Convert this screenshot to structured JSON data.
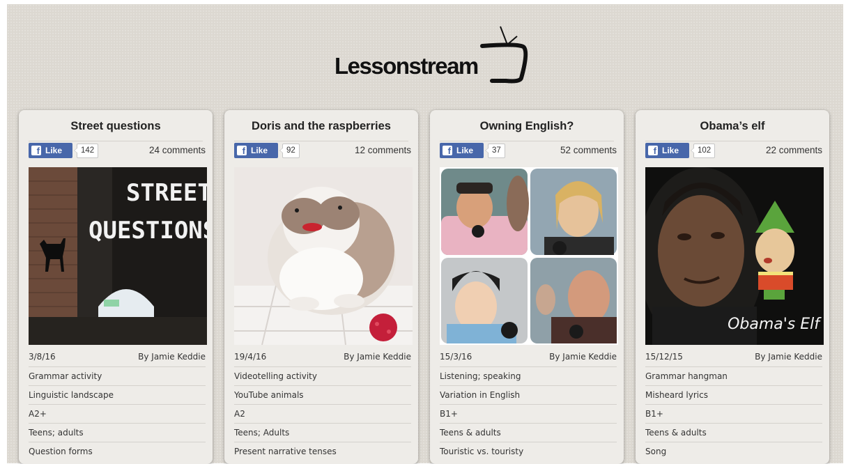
{
  "site": {
    "logo_text": "Lessonstream"
  },
  "lessons": [
    {
      "title": "Street questions",
      "like_label": "Like",
      "like_count": "142",
      "comments": "24 comments",
      "thumbnail": {
        "caption_line1": "STREET",
        "caption_line2": "QUESTIONS"
      },
      "date": "3/8/16",
      "author": "By Jamie Keddie",
      "tags": [
        "Grammar activity",
        "Linguistic landscape",
        "A2+",
        "Teens; adults",
        "Question forms"
      ]
    },
    {
      "title": "Doris and the raspberries",
      "like_label": "Like",
      "like_count": "92",
      "comments": "12 comments",
      "thumbnail": {},
      "date": "19/4/16",
      "author": "By Jamie Keddie",
      "tags": [
        "Videotelling activity",
        "YouTube animals",
        "A2",
        "Teens; Adults",
        "Present narrative tenses"
      ]
    },
    {
      "title": "Owning English?",
      "like_label": "Like",
      "like_count": "37",
      "comments": "52 comments",
      "thumbnail": {},
      "date": "15/3/16",
      "author": "By Jamie Keddie",
      "tags": [
        "Listening; speaking",
        "Variation in English",
        "B1+",
        "Teens & adults",
        "Touristic vs. touristy"
      ]
    },
    {
      "title": "Obama’s elf",
      "like_label": "Like",
      "like_count": "102",
      "comments": "22 comments",
      "thumbnail": {
        "caption": "Obama's Elf"
      },
      "date": "15/12/15",
      "author": "By Jamie Keddie",
      "tags": [
        "Grammar hangman",
        "Misheard lyrics",
        "B1+",
        "Teens & adults",
        "Song"
      ]
    }
  ]
}
